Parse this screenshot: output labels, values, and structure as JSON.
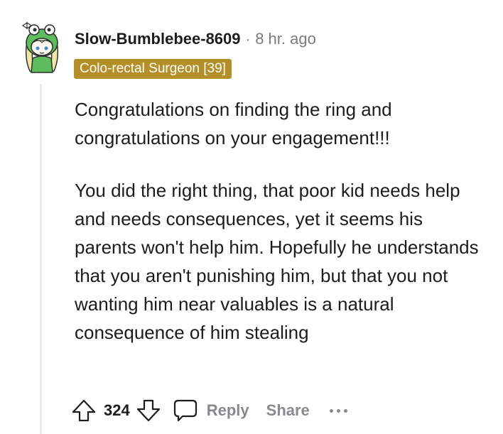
{
  "comment": {
    "author": "Slow-Bumblebee-8609",
    "separator": "·",
    "timestamp": "8 hr. ago",
    "flair": "Colo-rectal Surgeon [39]",
    "paragraphs": [
      "Congratulations on finding the ring and congratulations on your engagement!!!",
      "You did the right thing, that poor kid needs help and needs consequences, yet it seems his parents won't help him. Hopefully he understands that you aren't punishing him, but that you not wanting him near valuables is a natural consequence of him stealing"
    ]
  },
  "actions": {
    "upvote_icon": "arrow-up-outline-icon",
    "vote_count": "324",
    "downvote_icon": "arrow-down-outline-icon",
    "reply_icon": "speech-bubble-icon",
    "reply_label": "Reply",
    "share_label": "Share",
    "more_icon": "ellipsis-icon"
  },
  "colors": {
    "flair_background": "#b48f28",
    "meta_gray": "#7c7c7c",
    "action_gray": "#878a8c",
    "thread_line": "#ececec",
    "avatar_green": "#4caf50"
  }
}
